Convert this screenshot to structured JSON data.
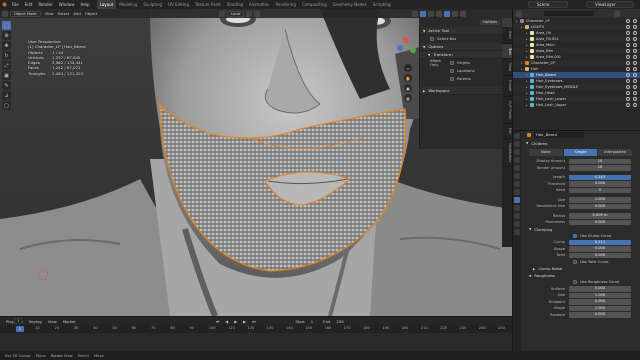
{
  "menubar": {
    "menus": [
      "File",
      "Edit",
      "Render",
      "Window",
      "Help"
    ],
    "workspaces": [
      "Layout",
      "Modeling",
      "Sculpting",
      "UV Editing",
      "Texture Paint",
      "Shading",
      "Animation",
      "Rendering",
      "Compositing",
      "Geometry Nodes",
      "Scripting"
    ],
    "active_workspace": "Layout",
    "scene": "Scene",
    "view_layer": "ViewLayer"
  },
  "viewport": {
    "mode": "Object Mode",
    "menus": [
      "View",
      "Select",
      "Add",
      "Object"
    ],
    "orientation": "Local",
    "overlay_title": "User Perspective",
    "overlay_object": "(1) Character_LP | Hair_Beard",
    "stats": [
      {
        "label": "Objects",
        "value": "1 / 44"
      },
      {
        "label": "Vertices",
        "value": "1,537 / 67,645"
      },
      {
        "label": "Edges",
        "value": "2,962 / 134,441"
      },
      {
        "label": "Faces",
        "value": "1,242 / 67,072"
      },
      {
        "label": "Triangles",
        "value": "2,484 / 131,323"
      }
    ]
  },
  "npanel": {
    "options_label": "Options",
    "active_tool": "Active Tool",
    "tool_name": "Select Box",
    "options": "Options",
    "transform": "Transform",
    "affect_only": "Affect Only",
    "affect_items": [
      "Origins",
      "Locations",
      "Parents"
    ],
    "workspace": "Workspace",
    "tabs": [
      "Item",
      "Tool",
      "View",
      "Create",
      "FLIP Fluids",
      "Edit",
      "HairModule"
    ]
  },
  "outliner": {
    "rows": [
      {
        "name": "Character_LP",
        "indent": 0
      },
      {
        "name": "LIGHTS",
        "indent": 1
      },
      {
        "name": "Area_Fill",
        "indent": 2
      },
      {
        "name": "Area_Fill.001",
        "indent": 2
      },
      {
        "name": "Area_Main",
        "indent": 2
      },
      {
        "name": "Area_Rim",
        "indent": 2
      },
      {
        "name": "Area_Rim.001",
        "indent": 2
      },
      {
        "name": "Character_LP",
        "indent": 1
      },
      {
        "name": "Hair",
        "indent": 1
      },
      {
        "name": "Hair_Beard",
        "indent": 2,
        "selected": true
      },
      {
        "name": "Hair_Eyebrows",
        "indent": 2
      },
      {
        "name": "Hair_Eyebrows_MIDDLE",
        "indent": 2
      },
      {
        "name": "Hair_Head",
        "indent": 2
      },
      {
        "name": "Hair_Lash_Lower",
        "indent": 2
      },
      {
        "name": "Hair_Lash_Upper",
        "indent": 2
      }
    ]
  },
  "properties": {
    "object_name": "Hair_Beard",
    "panel": "Children",
    "child_modes": [
      "None",
      "Simple",
      "Interpolated"
    ],
    "active_mode": "Simple",
    "rows_a": [
      {
        "label": "Display Amount",
        "value": "10"
      },
      {
        "label": "Render Amount",
        "value": "10"
      }
    ],
    "rows_b": [
      {
        "label": "Length",
        "value": "0.143",
        "style": "blue"
      },
      {
        "label": "Threshold",
        "value": "0.000"
      },
      {
        "label": "Seed",
        "value": "0"
      }
    ],
    "rows_c": [
      {
        "label": "Size",
        "value": "1.000"
      },
      {
        "label": "Randomize Size",
        "value": "0.000"
      }
    ],
    "rows_d": [
      {
        "label": "Radius",
        "value": "0.009 m"
      },
      {
        "label": "Roundness",
        "value": "0.000"
      }
    ],
    "clumping": "Clumping",
    "use_clump_curve": "Use Clump Curve",
    "clump_rows": [
      {
        "label": "Clump",
        "value": "0.111",
        "style": "blue"
      },
      {
        "label": "Shape",
        "value": "0.000"
      },
      {
        "label": "Twist",
        "value": "0.000"
      }
    ],
    "use_twist_curve": "Use Twist Curve",
    "clump_noise": "Clump Noise",
    "roughness": "Roughness",
    "use_roughness_curve": "Use Roughness Curve",
    "rough_rows": [
      {
        "label": "Uniform",
        "value": "0.000"
      },
      {
        "label": "Size",
        "value": "1.000"
      },
      {
        "label": "Endpoint",
        "value": "0.000"
      },
      {
        "label": "Shape",
        "value": "1.000"
      },
      {
        "label": "Random",
        "value": "0.000"
      }
    ]
  },
  "timeline": {
    "menus": [
      "Playback",
      "Keying",
      "View",
      "Marker"
    ],
    "current_frame": "1",
    "ticks": [
      "0",
      "10",
      "20",
      "30",
      "40",
      "50",
      "60",
      "70",
      "80",
      "90",
      "100",
      "110",
      "120",
      "130",
      "140",
      "150",
      "160",
      "170",
      "180",
      "190",
      "200",
      "210",
      "220",
      "230",
      "240",
      "250"
    ],
    "start_label": "Start",
    "start": "1",
    "end_label": "End",
    "end": "250"
  },
  "statusbar": {
    "items": [
      "Set 3D Cursor",
      "Move",
      "Rotate View",
      "Select",
      "Move"
    ],
    "version": "3.x"
  },
  "colors": {
    "accent": "#4772b3",
    "selection_outline": "#e8811a",
    "brand": "#e87d0d"
  }
}
